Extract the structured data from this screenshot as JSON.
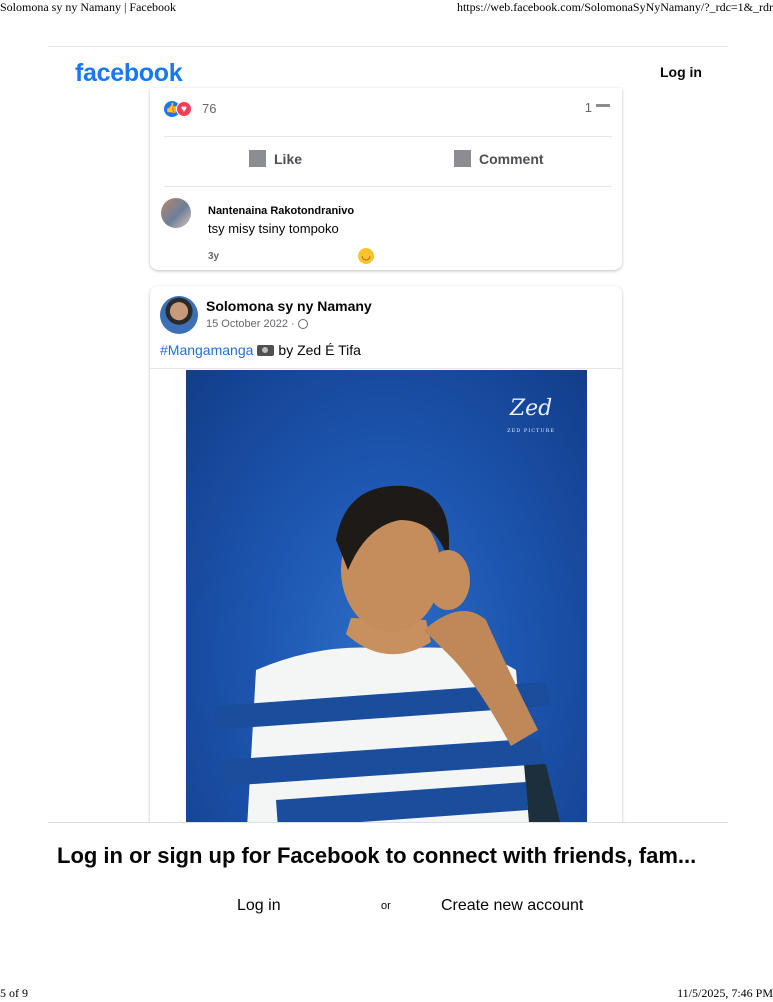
{
  "browser": {
    "page_title": "Solomona sy ny Namany | Facebook",
    "url": "https://web.facebook.com/SolomonaSyNyNamany/?_rdc=1&_rdr",
    "page_count": "5 of 9",
    "print_datetime": "11/5/2025, 7:46 PM"
  },
  "topbar": {
    "logo": "facebook",
    "login": "Log in"
  },
  "post1": {
    "reaction_count": "76",
    "comment_count": "1",
    "like_label": "Like",
    "comment_label": "Comment",
    "comment": {
      "author": "Nantenaina Rakotondranivo",
      "text": "tsy misy tsiny tompoko",
      "time": "3y"
    }
  },
  "post2": {
    "author": "Solomona sy ny Namany",
    "date": "15 October 2022",
    "date_sep": "·",
    "hashtag": "#Mangamanga",
    "caption_rest": "by Zed É Tifa",
    "watermark": "Zed",
    "watermark_sub": "ZED PICTURE"
  },
  "banner": {
    "title": "Log in or sign up for Facebook to connect with friends, fam...",
    "login": "Log in",
    "or": "or",
    "create": "Create new account"
  },
  "colors": {
    "brand": "#1877f2",
    "link": "#216fdb",
    "secondary_text": "#65676b"
  }
}
